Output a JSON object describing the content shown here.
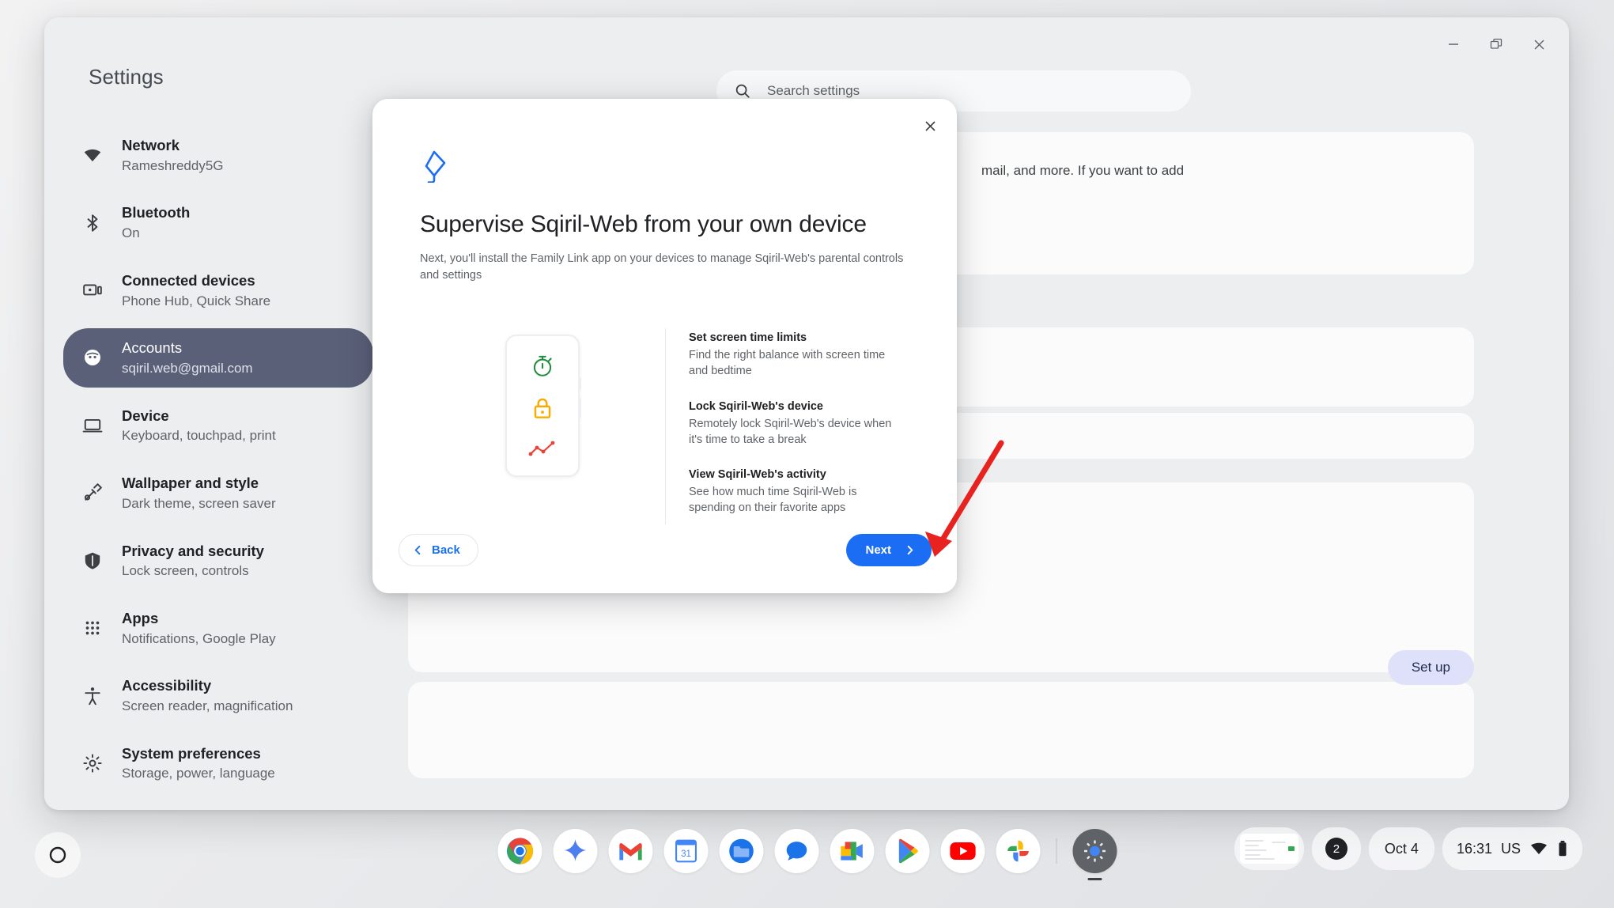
{
  "window": {
    "controls": [
      {
        "name": "minimize",
        "glyph": "minimize-icon"
      },
      {
        "name": "restore",
        "glyph": "restore-icon"
      },
      {
        "name": "close",
        "glyph": "close-icon"
      }
    ]
  },
  "sidebar": {
    "title": "Settings",
    "items": [
      {
        "icon": "wifi-icon",
        "label": "Network",
        "sublabel": "Rameshreddy5G",
        "active": false
      },
      {
        "icon": "bluetooth-icon",
        "label": "Bluetooth",
        "sublabel": "On",
        "active": false
      },
      {
        "icon": "devices-icon",
        "label": "Connected devices",
        "sublabel": "Phone Hub, Quick Share",
        "active": false
      },
      {
        "icon": "account-icon",
        "label": "Accounts",
        "sublabel": "sqiril.web@gmail.com",
        "active": true
      },
      {
        "icon": "laptop-icon",
        "label": "Device",
        "sublabel": "Keyboard, touchpad, print",
        "active": false
      },
      {
        "icon": "brush-icon",
        "label": "Wallpaper and style",
        "sublabel": "Dark theme, screen saver",
        "active": false
      },
      {
        "icon": "shield-icon",
        "label": "Privacy and security",
        "sublabel": "Lock screen, controls",
        "active": false
      },
      {
        "icon": "apps-grid-icon",
        "label": "Apps",
        "sublabel": "Notifications, Google Play",
        "active": false
      },
      {
        "icon": "accessibility-icon",
        "label": "Accessibility",
        "sublabel": "Screen reader, magnification",
        "active": false
      },
      {
        "icon": "gear-icon",
        "label": "System preferences",
        "sublabel": "Storage, power, language",
        "active": false
      }
    ]
  },
  "search": {
    "placeholder": "Search settings",
    "icon": "search-icon"
  },
  "background": {
    "card_text": "mail, and more. If you want to add",
    "setup_label": "Set up"
  },
  "dialog": {
    "logo": "family-link-icon",
    "close_icon": "close-icon",
    "title": "Supervise Sqiril-Web from your own device",
    "subtitle": "Next, you'll install the Family Link app on your devices to manage Sqiril-Web's parental controls and settings",
    "phone_icons": [
      {
        "name": "stopwatch-icon",
        "color": "#1e8e3e"
      },
      {
        "name": "lock-icon",
        "color": "#f9ab00"
      },
      {
        "name": "line-chart-icon",
        "color": "#ea4335"
      }
    ],
    "features": [
      {
        "title": "Set screen time limits",
        "description": "Find the right balance with screen time and bedtime"
      },
      {
        "title": "Lock Sqiril-Web's device",
        "description": "Remotely lock Sqiril-Web's device when it's time to take a break"
      },
      {
        "title": "View Sqiril-Web's activity",
        "description": "See how much time Sqiril-Web is spending on their favorite apps"
      }
    ],
    "back_label": "Back",
    "next_label": "Next",
    "back_icon": "chevron-left-icon",
    "next_icon": "chevron-right-icon",
    "accent_color": "#1b6ef3",
    "link_color": "#1a73e8"
  },
  "annotation": {
    "arrow_color": "#e8231f",
    "points_to": "Next"
  },
  "shelf": {
    "launcher_icon": "launcher-circle-icon",
    "apps": [
      {
        "name": "chrome-icon",
        "label": "Chrome",
        "active": false
      },
      {
        "name": "gemini-icon",
        "label": "Gemini",
        "active": false
      },
      {
        "name": "gmail-icon",
        "label": "Gmail",
        "active": false
      },
      {
        "name": "calendar-icon",
        "label": "Calendar",
        "active": false
      },
      {
        "name": "files-icon",
        "label": "Files",
        "active": false
      },
      {
        "name": "messages-icon",
        "label": "Messages",
        "active": false
      },
      {
        "name": "meet-icon",
        "label": "Meet",
        "active": false
      },
      {
        "name": "play-store-icon",
        "label": "Play Store",
        "active": false
      },
      {
        "name": "youtube-icon",
        "label": "YouTube",
        "active": false
      },
      {
        "name": "photos-icon",
        "label": "Photos",
        "active": false
      },
      {
        "name": "settings-icon",
        "label": "Settings",
        "active": true
      }
    ],
    "tray": {
      "preview_icon": "window-preview-icon",
      "notification_count": "2",
      "date": "Oct 4",
      "time": "16:31",
      "locale": "US",
      "wifi_icon": "wifi-icon",
      "battery_icon": "battery-icon"
    }
  }
}
